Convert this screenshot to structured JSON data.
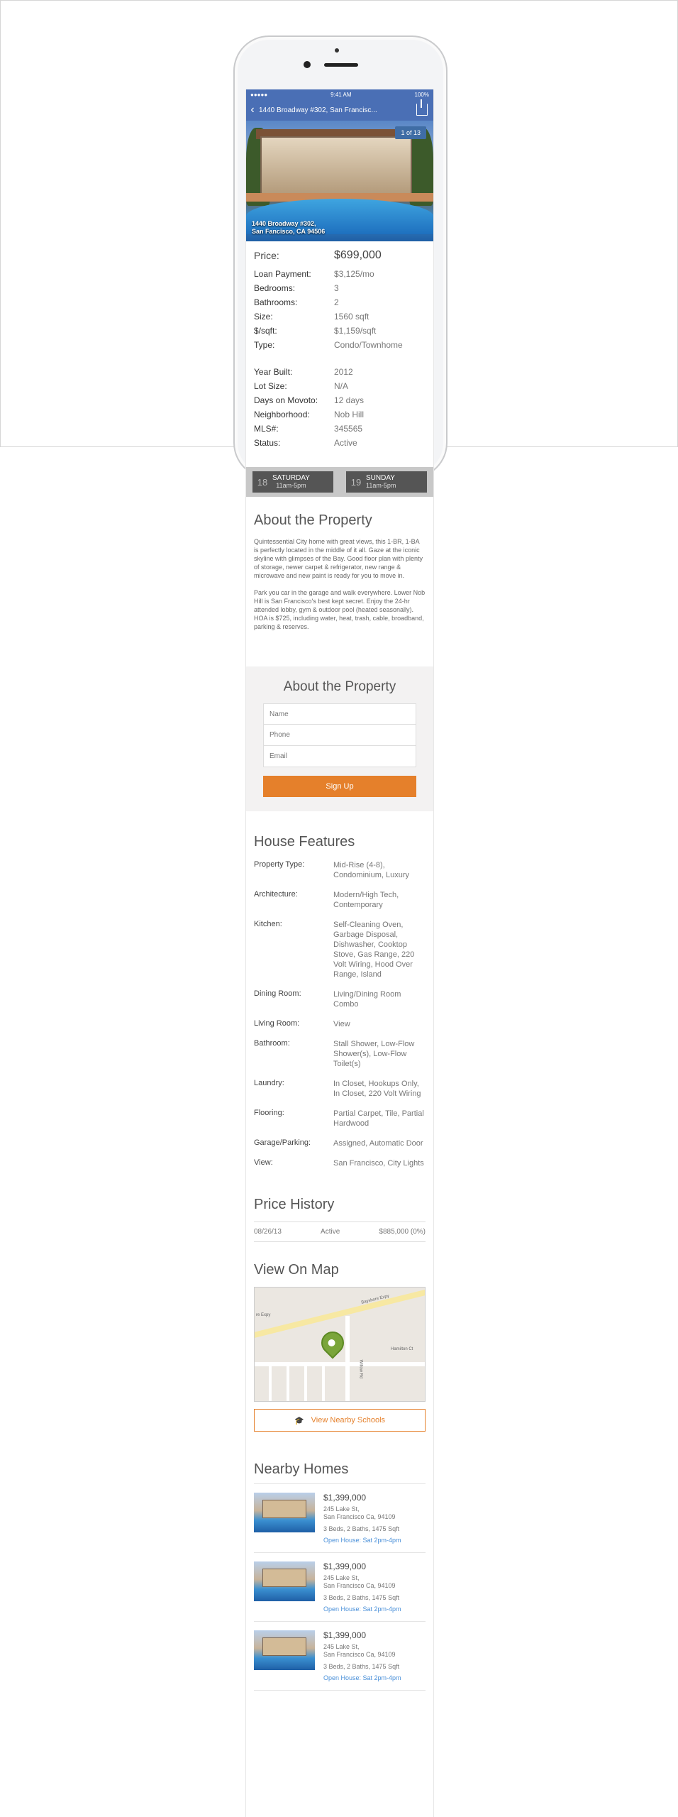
{
  "status_bar": {
    "signal": "●●●●●",
    "time": "9:41 AM",
    "battery": "100%"
  },
  "nav": {
    "title": "1440 Broadway #302, San Francisc..."
  },
  "photo": {
    "counter": "1 of 13",
    "address_line1": "1440 Broadway #302,",
    "address_line2": "San Fancisco, CA 94506"
  },
  "details": {
    "price": {
      "label": "Price:",
      "value": "$699,000"
    },
    "rows": [
      {
        "label": "Loan Payment:",
        "value": "$3,125/mo"
      },
      {
        "label": "Bedrooms:",
        "value": "3"
      },
      {
        "label": "Bathrooms:",
        "value": "2"
      },
      {
        "label": "Size:",
        "value": "1560 sqft"
      },
      {
        "label": "$/sqft:",
        "value": "$1,159/sqft"
      },
      {
        "label": "Type:",
        "value": "Condo/Townhome"
      }
    ],
    "rows2": [
      {
        "label": "Year Built:",
        "value": "2012"
      },
      {
        "label": "Lot Size:",
        "value": "N/A"
      },
      {
        "label": "Days on Movoto:",
        "value": "12 days"
      },
      {
        "label": "Neighborhood:",
        "value": "Nob Hill"
      },
      {
        "label": "MLS#:",
        "value": "345565"
      },
      {
        "label": "Status:",
        "value": "Active"
      }
    ]
  },
  "open_house": [
    {
      "day_num": "18",
      "day": "SATURDAY",
      "time": "11am-5pm"
    },
    {
      "day_num": "19",
      "day": "SUNDAY",
      "time": "11am-5pm"
    }
  ],
  "about": {
    "title": "About the Property",
    "p1": "Quintessential City home with great views, this 1-BR, 1-BA is perfectly located in the middle of it all. Gaze at the iconic skyline with glimpses of the Bay. Good floor plan with plenty of storage, newer carpet & refrigerator, new range & microwave and new paint is ready for you to move in.",
    "p2": "Park you car in the garage and walk everywhere. Lower Nob Hill is San Francisco's best kept secret. Enjoy the 24-hr attended lobby, gym & outdoor pool (heated seasonally). HOA is $725, including water, heat, trash, cable, broadband, parking & reserves."
  },
  "signup": {
    "title": "About the Property",
    "name_placeholder": "Name",
    "phone_placeholder": "Phone",
    "email_placeholder": "Email",
    "button": "Sign Up"
  },
  "features": {
    "title": "House Features",
    "rows": [
      {
        "label": "Property Type:",
        "value": "Mid-Rise (4-8), Condominium, Luxury"
      },
      {
        "label": "Architecture:",
        "value": "Modern/High Tech, Contemporary"
      },
      {
        "label": "Kitchen:",
        "value": "Self-Cleaning Oven, Garbage Disposal, Dishwasher, Cooktop Stove, Gas Range, 220 Volt Wiring, Hood Over Range, Island"
      },
      {
        "label": "Dining Room:",
        "value": "Living/Dining Room Combo"
      },
      {
        "label": "Living Room:",
        "value": "View"
      },
      {
        "label": "Bathroom:",
        "value": "Stall Shower, Low-Flow Shower(s), Low-Flow Toilet(s)"
      },
      {
        "label": "Laundry:",
        "value": "In Closet, Hookups Only, In Closet, 220 Volt Wiring"
      },
      {
        "label": "Flooring:",
        "value": "Partial Carpet, Tile, Partial Hardwood"
      },
      {
        "label": "Garage/Parking:",
        "value": "Assigned, Automatic Door"
      },
      {
        "label": "View:",
        "value": "San Francisco, City Lights"
      }
    ]
  },
  "history": {
    "title": "Price History",
    "row": {
      "date": "08/26/13",
      "status": "Active",
      "price": "$885,000 (0%)"
    }
  },
  "map": {
    "title": "View On Map",
    "labels": {
      "bayshore": "Bayshore Expy",
      "hamilton": "Hamilton Ct",
      "willow": "Willow Rd",
      "expy": "re Expy"
    },
    "schools_button": "View Nearby Schools"
  },
  "nearby": {
    "title": "Nearby Homes",
    "homes": [
      {
        "price": "$1,399,000",
        "addr1": "245 Lake St,",
        "addr2": "San Francisco Ca, 94109",
        "beds": "3 Beds, 2 Baths, 1475 Sqft",
        "open": "Open House: Sat 2pm-4pm"
      },
      {
        "price": "$1,399,000",
        "addr1": "245 Lake St,",
        "addr2": "San Francisco Ca, 94109",
        "beds": "3 Beds, 2 Baths, 1475 Sqft",
        "open": "Open House: Sat 2pm-4pm"
      },
      {
        "price": "$1,399,000",
        "addr1": "245 Lake St,",
        "addr2": "San Francisco Ca, 94109",
        "beds": "3 Beds, 2 Baths, 1475 Sqft",
        "open": "Open House: Sat 2pm-4pm"
      }
    ]
  }
}
